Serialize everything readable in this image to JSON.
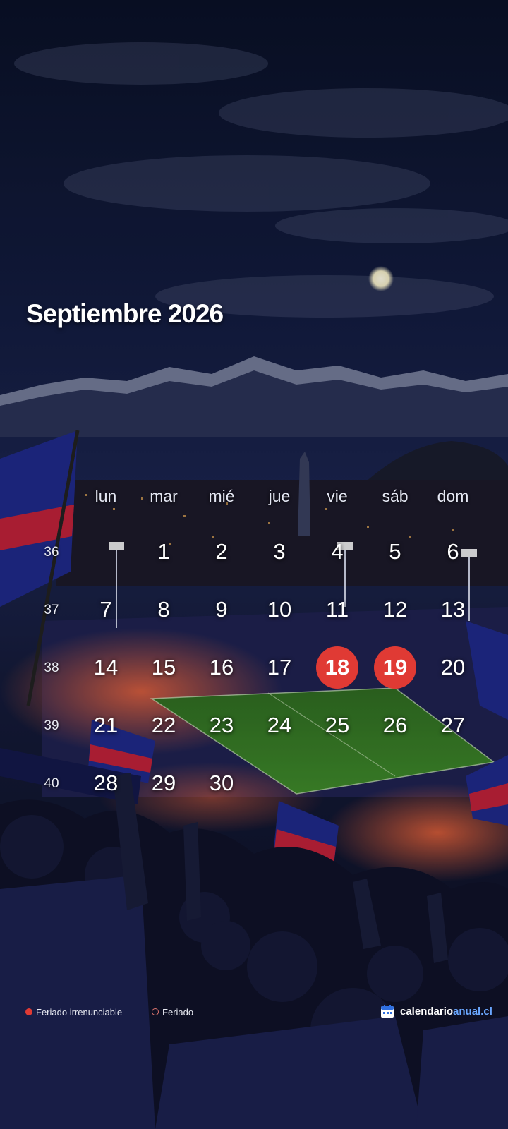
{
  "title": "Septiembre 2026",
  "weekday_labels": [
    "lun",
    "mar",
    "mié",
    "jue",
    "vie",
    "sáb",
    "dom"
  ],
  "week_numbers": [
    "36",
    "37",
    "38",
    "39",
    "40"
  ],
  "weeks": [
    [
      "",
      "1",
      "2",
      "3",
      "4",
      "5",
      "6"
    ],
    [
      "7",
      "8",
      "9",
      "10",
      "11",
      "12",
      "13"
    ],
    [
      "14",
      "15",
      "16",
      "17",
      "18",
      "19",
      "20"
    ],
    [
      "21",
      "22",
      "23",
      "24",
      "25",
      "26",
      "27"
    ],
    [
      "28",
      "29",
      "30",
      "",
      "",
      "",
      ""
    ]
  ],
  "holidays_irrenunciable": [
    "18",
    "19"
  ],
  "legend": {
    "irrenunciable_label": "Feriado irrenunciable",
    "feriado_label": "Feriado"
  },
  "brand": {
    "part1": "calendario",
    "part2": "anual.cl"
  },
  "colors": {
    "holiday_red": "#e03a34",
    "brand_blue": "#6aa7ff",
    "sky": "#0b1230"
  },
  "icons": [
    "calendar-logo-icon"
  ]
}
